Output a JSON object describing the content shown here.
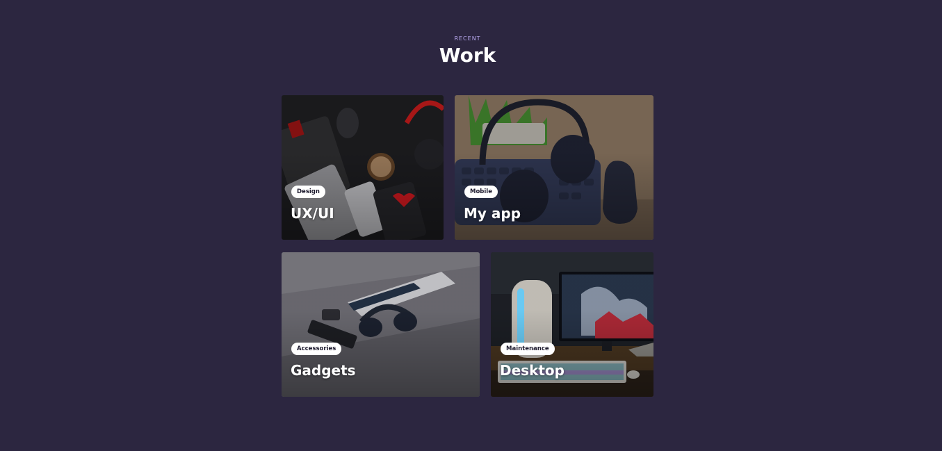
{
  "section": {
    "eyebrow": "RECENT",
    "title": "Work"
  },
  "projects": [
    {
      "tag": "Design",
      "title": "UX/UI",
      "image": "desk-flatlay-dark"
    },
    {
      "tag": "Mobile",
      "title": "My app",
      "image": "headphones-keyboard"
    },
    {
      "tag": "Accessories",
      "title": "Gadgets",
      "image": "headphones-phone-desk"
    },
    {
      "tag": "Maintenance",
      "title": "Desktop",
      "image": "gaming-pc-setup"
    }
  ],
  "colors": {
    "background": "#2c2640",
    "accent": "#b9a9f0",
    "pill_bg": "#ffffff",
    "pill_text": "#1d1a2e"
  }
}
